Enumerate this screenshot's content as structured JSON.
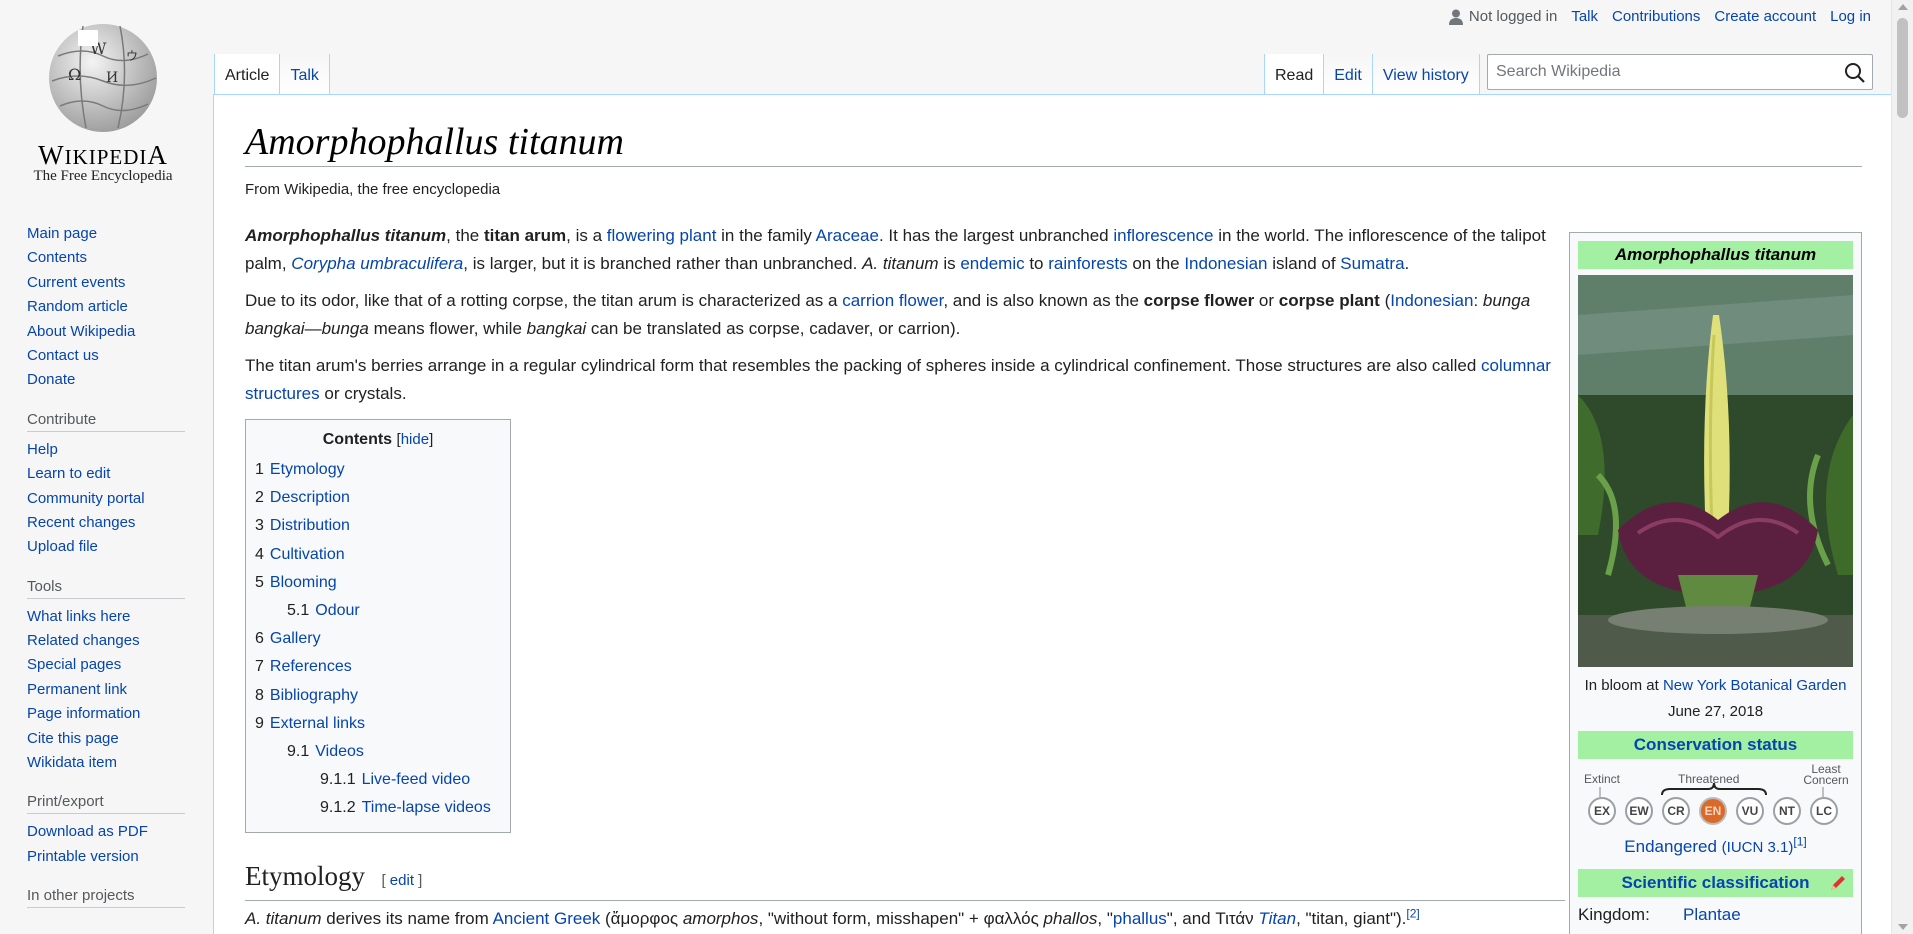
{
  "logo": {
    "wordmark": "Wikipedia",
    "tagline": "The Free Encyclopedia"
  },
  "personal": {
    "not_logged_in": "Not logged in",
    "talk": "Talk",
    "contributions": "Contributions",
    "create_account": "Create account",
    "log_in": "Log in"
  },
  "tabs": {
    "article": "Article",
    "talk": "Talk",
    "read": "Read",
    "edit": "Edit",
    "view_history": "View history"
  },
  "search": {
    "placeholder": "Search Wikipedia"
  },
  "sidebar": {
    "navigation": [
      "Main page",
      "Contents",
      "Current events",
      "Random article",
      "About Wikipedia",
      "Contact us",
      "Donate"
    ],
    "contribute": {
      "heading": "Contribute",
      "items": [
        "Help",
        "Learn to edit",
        "Community portal",
        "Recent changes",
        "Upload file"
      ]
    },
    "tools": {
      "heading": "Tools",
      "items": [
        "What links here",
        "Related changes",
        "Special pages",
        "Permanent link",
        "Page information",
        "Cite this page",
        "Wikidata item"
      ]
    },
    "print": {
      "heading": "Print/export",
      "items": [
        "Download as PDF",
        "Printable version"
      ]
    },
    "projects": {
      "heading": "In other projects"
    }
  },
  "article": {
    "title": "Amorphophallus titanum",
    "site_sub": "From Wikipedia, the free encyclopedia",
    "p1": {
      "t1": "Amorphophallus titanum",
      "t2": ", the ",
      "t3": "titan arum",
      "t4": ", is a ",
      "l1": "flowering plant",
      "t5": " in the family ",
      "l2": "Araceae",
      "t6": ". It has the largest unbranched ",
      "l3": "inflorescence",
      "t7": " in the world. The inflorescence of the talipot palm, ",
      "l4": "Corypha umbraculifera",
      "t8": ", is larger, but it is branched rather than unbranched. ",
      "t9": "A. titanum",
      "t10": " is ",
      "l5": "endemic",
      "t11": " to ",
      "l6": "rainforests",
      "t12": " on the ",
      "l7": "Indonesian",
      "t13": " island of ",
      "l8": "Sumatra",
      "t14": "."
    },
    "p2": {
      "t1": "Due to its odor, like that of a rotting corpse, the titan arum is characterized as a ",
      "l1": "carrion flower",
      "t2": ", and is also known as the ",
      "t3": "corpse flower",
      "t4": " or ",
      "t5": "corpse plant",
      "t6": " (",
      "l2": "Indonesian",
      "t7": ": ",
      "t8": "bunga bangkai",
      "t9": "—",
      "t10": "bunga",
      "t11": " means flower, while ",
      "t12": "bangkai",
      "t13": " can be translated as corpse, cadaver, or carrion)."
    },
    "p3": {
      "t1": "The titan arum's berries arrange in a regular cylindrical form that resembles the packing of spheres inside a cylindrical confinement. Those structures are also called ",
      "l1": "columnar structures",
      "t2": " or crystals."
    }
  },
  "toc": {
    "title": "Contents",
    "hide": "hide",
    "items": [
      {
        "num": "1",
        "label": "Etymology"
      },
      {
        "num": "2",
        "label": "Description"
      },
      {
        "num": "3",
        "label": "Distribution"
      },
      {
        "num": "4",
        "label": "Cultivation"
      },
      {
        "num": "5",
        "label": "Blooming"
      },
      {
        "num": "5.1",
        "label": "Odour"
      },
      {
        "num": "6",
        "label": "Gallery"
      },
      {
        "num": "7",
        "label": "References"
      },
      {
        "num": "8",
        "label": "Bibliography"
      },
      {
        "num": "9",
        "label": "External links"
      },
      {
        "num": "9.1",
        "label": "Videos"
      },
      {
        "num": "9.1.1",
        "label": "Live-feed video"
      },
      {
        "num": "9.1.2",
        "label": "Time-lapse videos"
      }
    ]
  },
  "etymology": {
    "heading": "Etymology",
    "edit": "edit",
    "t1": "A. titanum",
    "t2": " derives its name from ",
    "l1": "Ancient Greek",
    "t3": " (ἄμορφος ",
    "t4": "amorphos",
    "t5": ", \"without form, misshapen\" + φαλλός ",
    "t6": "phallos",
    "t7": ", \"",
    "l2": "phallus",
    "t8": "\", and Τιτάν ",
    "l3": "Titan",
    "t9": ", \"titan, giant\").",
    "ref": "[2]"
  },
  "infobox": {
    "title": "Amorphophallus titanum",
    "caption_pre": "In bloom at ",
    "caption_link": "New York Botanical Garden",
    "caption_date": "June 27, 2018",
    "conservation_heading": "Conservation status",
    "scale_labels": {
      "extinct": "Extinct",
      "threatened": "Threatened",
      "least": "Least",
      "concern": "Concern"
    },
    "statuses": [
      "EX",
      "EW",
      "CR",
      "EN",
      "VU",
      "NT",
      "LC"
    ],
    "status_link": "Endangered",
    "status_iucn": "(IUCN 3.1)",
    "status_ref": "[1]",
    "classification_heading": "Scientific classification",
    "kingdom_label": "Kingdom:",
    "kingdom_value": "Plantae"
  },
  "colors": {
    "link": "#0645ad",
    "infobox_header": "#a3f0a3",
    "endangered": "#d96a2a"
  }
}
